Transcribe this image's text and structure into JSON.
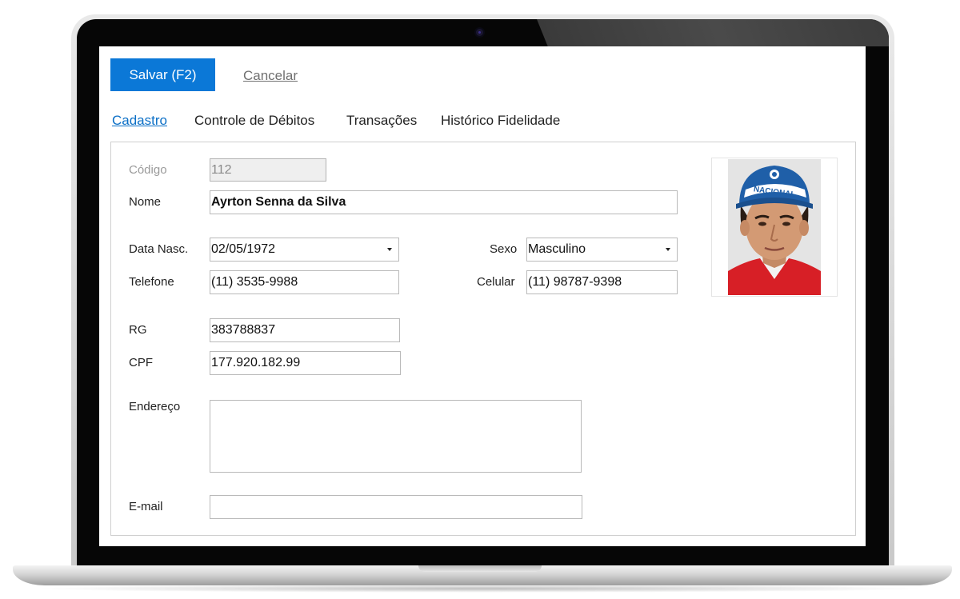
{
  "toolbar": {
    "save_label": "Salvar (F2)",
    "cancel_label": "Cancelar"
  },
  "tabs": [
    {
      "label": "Cadastro",
      "active": true
    },
    {
      "label": "Controle de Débitos",
      "active": false
    },
    {
      "label": "Transações",
      "active": false
    },
    {
      "label": "Histórico Fidelidade",
      "active": false
    }
  ],
  "form": {
    "codigo": {
      "label": "Código",
      "value": "112"
    },
    "nome": {
      "label": "Nome",
      "value": "Ayrton Senna da Silva"
    },
    "data_nasc": {
      "label": "Data Nasc.",
      "value": "02/05/1972"
    },
    "sexo": {
      "label": "Sexo",
      "value": "Masculino"
    },
    "telefone": {
      "label": "Telefone",
      "value": "(11) 3535-9988"
    },
    "celular": {
      "label": "Celular",
      "value": "(11) 98787-9398"
    },
    "rg": {
      "label": "RG",
      "value": "383788837"
    },
    "cpf": {
      "label": "CPF",
      "value": "177.920.182.99"
    },
    "endereco": {
      "label": "Endereço",
      "value": ""
    },
    "email": {
      "label": "E-mail",
      "value": ""
    }
  },
  "photo": {
    "cap_text": "NACIONAL"
  },
  "colors": {
    "accent": "#0b78d7",
    "active_tab": "#0b6fc6",
    "bezel": "#060606",
    "cap_blue": "#1f5fa8",
    "jacket_red": "#d71f26"
  }
}
